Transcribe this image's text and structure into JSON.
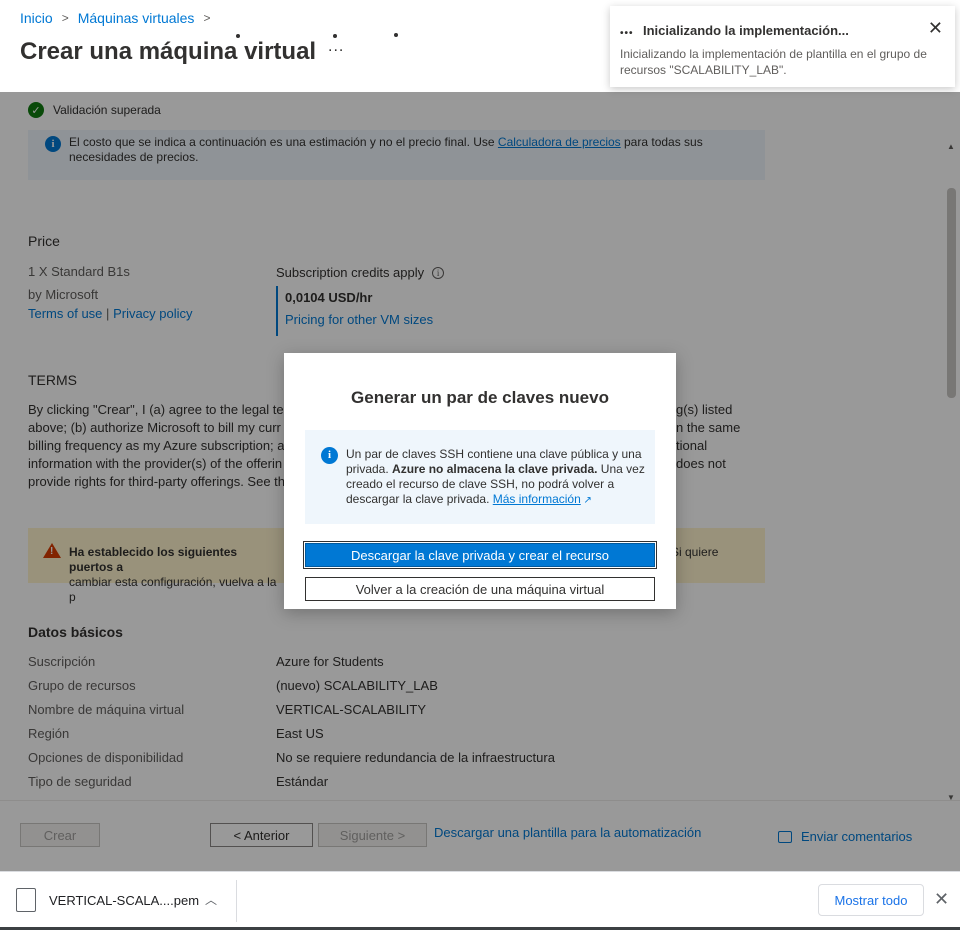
{
  "header": {
    "breadcrumb": [
      "Inicio",
      "Máquinas virtuales"
    ],
    "title": "Crear una máquina virtual",
    "more": "..."
  },
  "validation": {
    "text": "Validación superada"
  },
  "cost_info": {
    "text_before": "El costo que se indica a continuación es una estimación y no el precio final. Use ",
    "link": "Calculadora de precios",
    "text_after": " para todas sus necesidades de precios."
  },
  "price": {
    "title": "Price",
    "product": "1 X Standard B1s",
    "by": "by Microsoft",
    "terms_of_use": "Terms of use",
    "separator": "|",
    "privacy_policy": "Privacy policy",
    "subscription_credits": "Subscription credits apply",
    "value": "0,0104 USD/hr",
    "other_sizes": "Pricing for other VM sizes"
  },
  "terms": {
    "title": "TERMS",
    "lines": [
      "By clicking \"Crear\", I (a) agree to the legal ter",
      "above; (b) authorize Microsoft to bill my curr",
      "billing frequency as my Azure subscription; a",
      "information with the provider(s) of the offerin",
      "provide rights for third-party offerings. See th"
    ],
    "right_lines": [
      "g(s) listed",
      "n the same",
      "tional",
      "does not",
      ""
    ]
  },
  "warning": {
    "bold": "Ha establecido los siguientes puertos a",
    "line2": "cambiar esta configuración, vuelva a la p",
    "right": "Si quiere"
  },
  "basics": {
    "title": "Datos básicos",
    "rows": [
      {
        "k": "Suscripción",
        "v": "Azure for Students"
      },
      {
        "k": "Grupo de recursos",
        "v": "(nuevo) SCALABILITY_LAB"
      },
      {
        "k": "Nombre de máquina virtual",
        "v": "VERTICAL-SCALABILITY"
      },
      {
        "k": "Región",
        "v": "East US"
      },
      {
        "k": "Opciones de disponibilidad",
        "v": "No se requiere redundancia de la infraestructura"
      },
      {
        "k": "Tipo de seguridad",
        "v": "Estándar"
      }
    ]
  },
  "footer": {
    "create": "Crear",
    "previous": "< Anterior",
    "next": "Siguiente >",
    "template_link": "Descargar una plantilla para la automatización",
    "feedback": "Enviar comentarios"
  },
  "toast": {
    "title": "Inicializando la implementación...",
    "body": "Inicializando la implementación de plantilla en el grupo de recursos \"SCALABILITY_LAB\"."
  },
  "modal": {
    "title": "Generar un par de claves nuevo",
    "info_1": "Un par de claves SSH contiene una clave pública y una privada. ",
    "info_bold": "Azure no almacena la clave privada.",
    "info_2": " Una vez creado el recurso de clave SSH, no podrá volver a descargar la clave privada. ",
    "info_link": "Más información",
    "primary": "Descargar la clave privada y crear el recurso",
    "secondary": "Volver a la creación de una máquina virtual"
  },
  "downloads": {
    "file": "VERTICAL-SCALA....pem",
    "show_all": "Mostrar todo"
  },
  "colors": {
    "accent": "#0078d4",
    "success": "#107c10",
    "warning": "#d83b01"
  }
}
